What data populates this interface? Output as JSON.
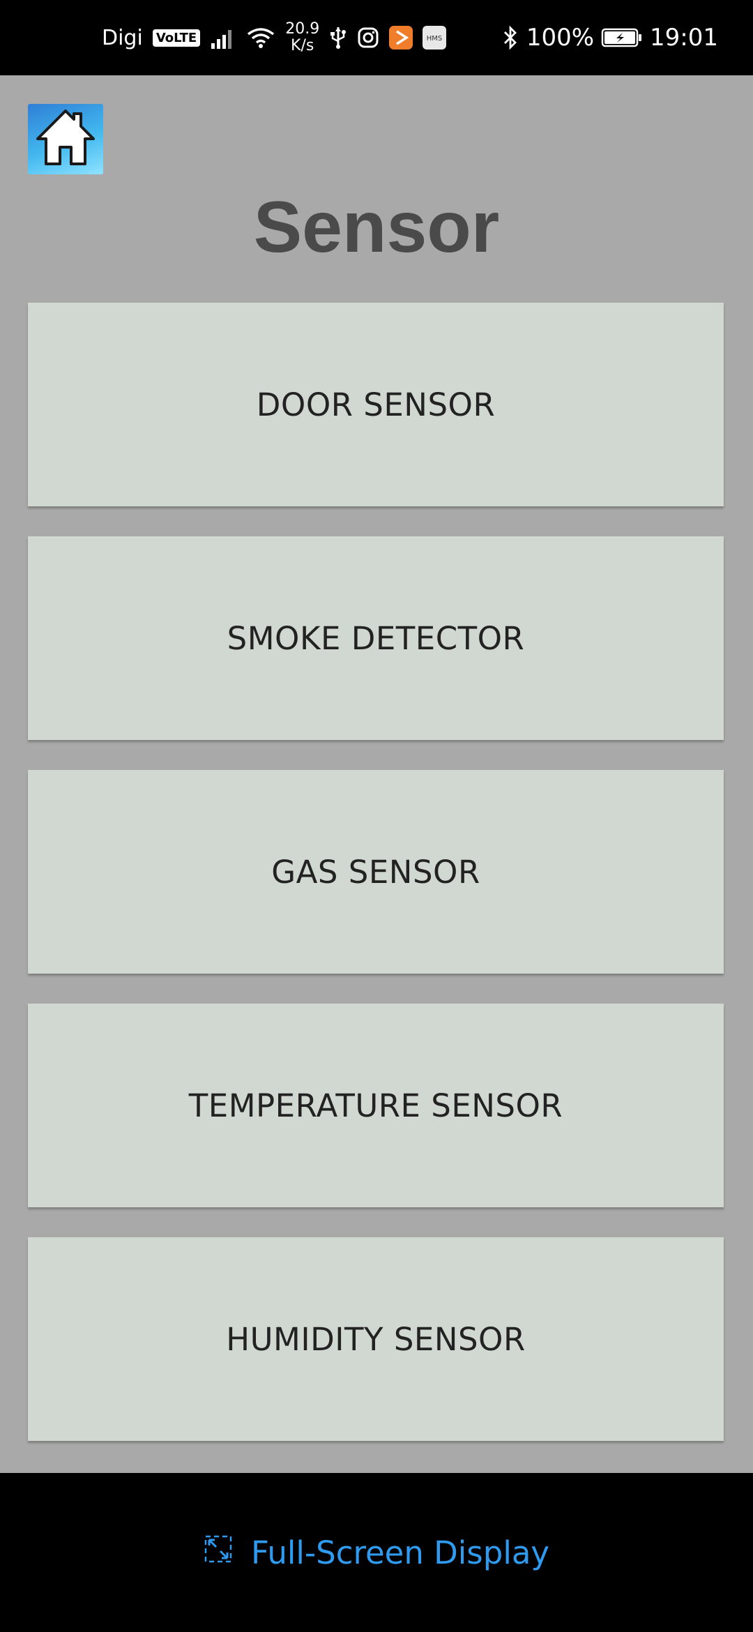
{
  "status_bar": {
    "carrier": "Digi",
    "volte": "VoLTE",
    "speed_value": "20.9",
    "speed_unit": "K/s",
    "hms_badge": "HMS",
    "battery_percent": "100%",
    "time": "19:01"
  },
  "header": {
    "home_icon": "home-icon",
    "title": "Sensor"
  },
  "sensors": [
    {
      "label": "DOOR SENSOR"
    },
    {
      "label": "SMOKE DETECTOR"
    },
    {
      "label": "GAS SENSOR"
    },
    {
      "label": "TEMPERATURE SENSOR"
    },
    {
      "label": "HUMIDITY SENSOR"
    }
  ],
  "footer": {
    "fullscreen_label": "Full-Screen Display",
    "fullscreen_icon": "expand-icon"
  },
  "colors": {
    "background": "#a9a9a9",
    "button": "#d1d8d2",
    "title": "#4a4a4a",
    "link": "#2f9bf0"
  }
}
